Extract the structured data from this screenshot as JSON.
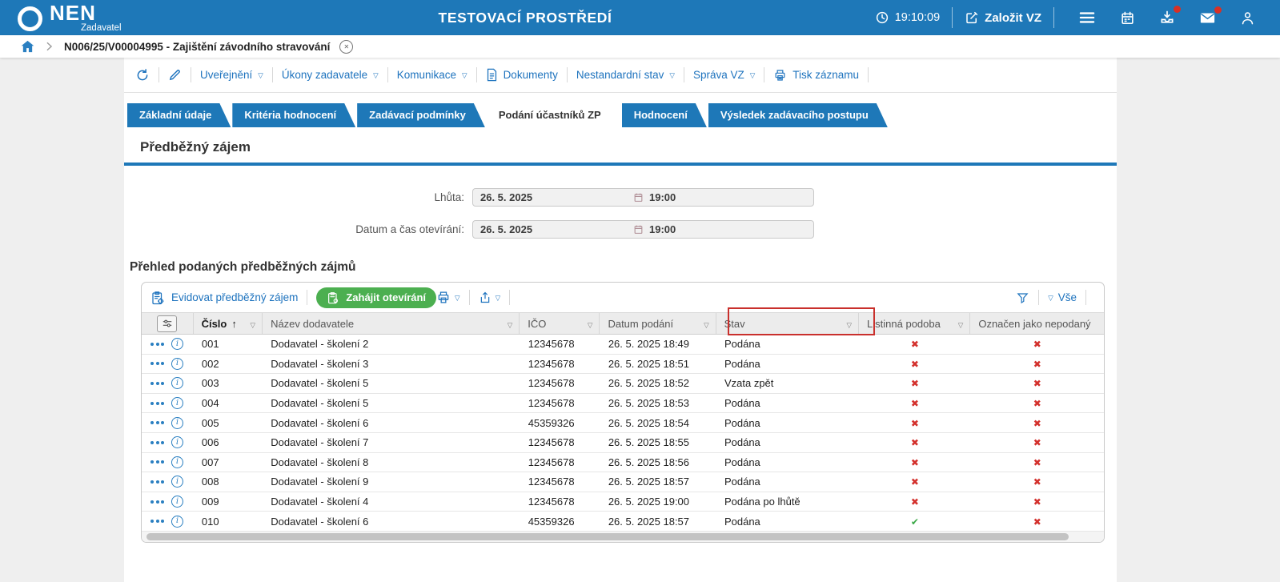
{
  "header": {
    "brand": "NEN",
    "brand_sub": "Zadavatel",
    "env_title": "TESTOVACÍ PROSTŘEDÍ",
    "time": "19:10:09",
    "create_label": "Založit VZ"
  },
  "breadcrumb": {
    "record": "N006/25/V00004995 - Zajištění závodního stravování"
  },
  "action_toolbar": {
    "uverejneni": "Uveřejnění",
    "ukony": "Úkony zadavatele",
    "komunikace": "Komunikace",
    "dokumenty": "Dokumenty",
    "nestandardni": "Nestandardní stav",
    "sprava": "Správa VZ",
    "tisk": "Tisk záznamu"
  },
  "tabs": {
    "active_index": 3,
    "items": [
      "Základní údaje",
      "Kritéria hodnocení",
      "Zadávací podmínky",
      "Podání účastníků ZP",
      "Hodnocení",
      "Výsledek zadávacího postupu"
    ]
  },
  "section": {
    "title": "Předběžný zájem"
  },
  "form": {
    "fields": [
      {
        "label": "Lhůta:",
        "date": "26. 5. 2025",
        "time": "19:00"
      },
      {
        "label": "Datum a čas otevírání:",
        "date": "26. 5. 2025",
        "time": "19:00"
      }
    ]
  },
  "table": {
    "title": "Přehled podaných předběžných zájmů",
    "toolbar": {
      "register_label": "Evidovat předběžný zájem",
      "open_label": "Zahájit otevírání",
      "all_label": "Vše"
    },
    "columns": [
      "Číslo",
      "Název dodavatele",
      "IČO",
      "Datum podání",
      "Stav",
      "Listinná podoba",
      "Označen jako nepodaný"
    ],
    "rows": [
      {
        "cislo": "001",
        "nazev": "Dodavatel - školení 2",
        "ico": "12345678",
        "datum": "26. 5. 2025 18:49",
        "stav": "Podána",
        "listinna": "x",
        "nepodany": "x"
      },
      {
        "cislo": "002",
        "nazev": "Dodavatel - školení 3",
        "ico": "12345678",
        "datum": "26. 5. 2025 18:51",
        "stav": "Podána",
        "listinna": "x",
        "nepodany": "x"
      },
      {
        "cislo": "003",
        "nazev": "Dodavatel - školení 5",
        "ico": "12345678",
        "datum": "26. 5. 2025 18:52",
        "stav": "Vzata zpět",
        "listinna": "x",
        "nepodany": "x"
      },
      {
        "cislo": "004",
        "nazev": "Dodavatel - školení 5",
        "ico": "12345678",
        "datum": "26. 5. 2025 18:53",
        "stav": "Podána",
        "listinna": "x",
        "nepodany": "x"
      },
      {
        "cislo": "005",
        "nazev": "Dodavatel - školení 6",
        "ico": "45359326",
        "datum": "26. 5. 2025 18:54",
        "stav": "Podána",
        "listinna": "x",
        "nepodany": "x"
      },
      {
        "cislo": "006",
        "nazev": "Dodavatel - školení 7",
        "ico": "12345678",
        "datum": "26. 5. 2025 18:55",
        "stav": "Podána",
        "listinna": "x",
        "nepodany": "x"
      },
      {
        "cislo": "007",
        "nazev": "Dodavatel - školení 8",
        "ico": "12345678",
        "datum": "26. 5. 2025 18:56",
        "stav": "Podána",
        "listinna": "x",
        "nepodany": "x"
      },
      {
        "cislo": "008",
        "nazev": "Dodavatel - školení 9",
        "ico": "12345678",
        "datum": "26. 5. 2025 18:57",
        "stav": "Podána",
        "listinna": "x",
        "nepodany": "x"
      },
      {
        "cislo": "009",
        "nazev": "Dodavatel - školení 4",
        "ico": "12345678",
        "datum": "26. 5. 2025 19:00",
        "stav": "Podána po lhůtě",
        "listinna": "x",
        "nepodany": "x"
      },
      {
        "cislo": "010",
        "nazev": "Dodavatel - školení 6",
        "ico": "45359326",
        "datum": "26. 5. 2025 18:57",
        "stav": "Podána",
        "listinna": "check",
        "nepodany": "x"
      }
    ]
  },
  "colors": {
    "header_blue": "#1e78b8",
    "link_blue": "#1e73be",
    "accent_green": "#4caf50",
    "mark_red": "#d3302c",
    "mark_green": "#39a845",
    "highlight_red": "#c9302c"
  }
}
